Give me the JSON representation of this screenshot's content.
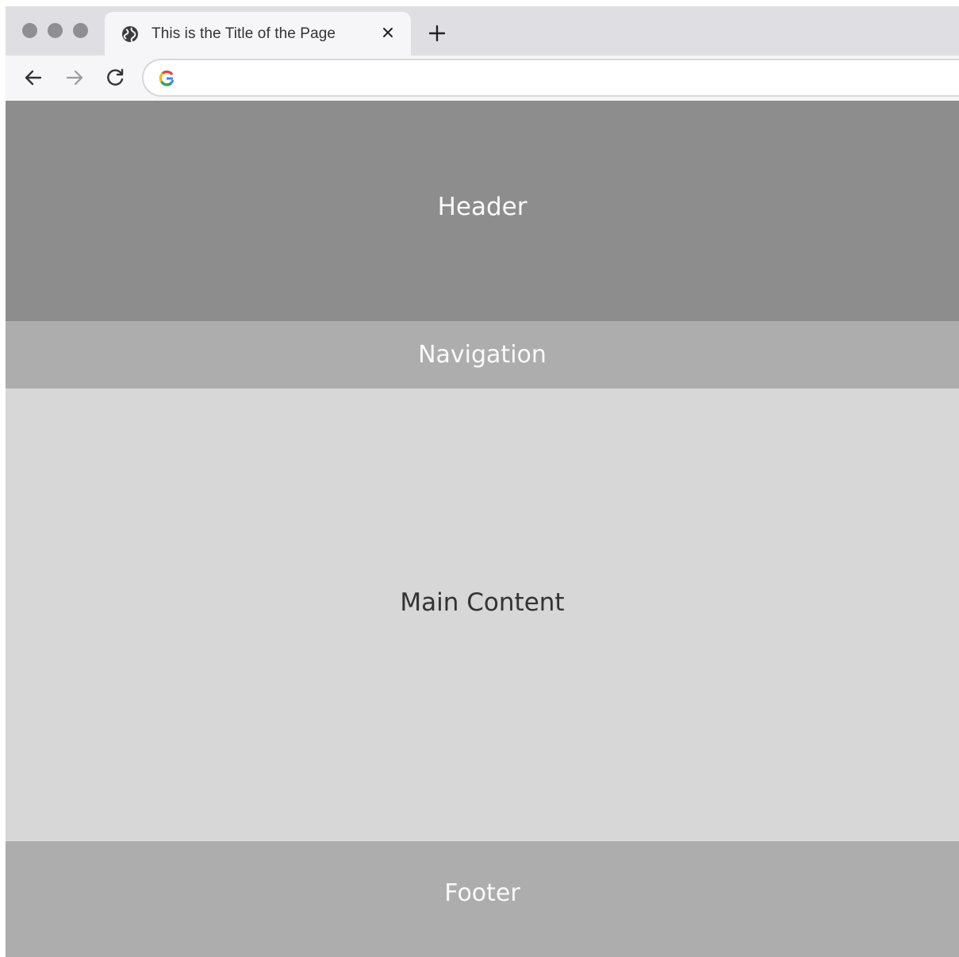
{
  "browser": {
    "tab": {
      "title": "This is the Title of the Page",
      "favicon": "globe-icon",
      "close_icon": "close-icon"
    },
    "new_tab_icon": "plus-icon",
    "toolbar": {
      "back_icon": "arrow-left-icon",
      "forward_icon": "arrow-right-icon",
      "reload_icon": "reload-icon",
      "address": {
        "search_engine_icon": "google-g-icon",
        "value": ""
      }
    }
  },
  "page": {
    "header": {
      "label": "Header"
    },
    "navigation": {
      "label": "Navigation"
    },
    "main": {
      "label": "Main Content"
    },
    "footer": {
      "label": "Footer"
    }
  },
  "colors": {
    "header_bg": "#8d8d8d",
    "nav_bg": "#adadad",
    "main_bg": "#d7d7d7",
    "footer_bg": "#adadad",
    "light_text": "#fafafa",
    "dark_text": "#333333"
  }
}
